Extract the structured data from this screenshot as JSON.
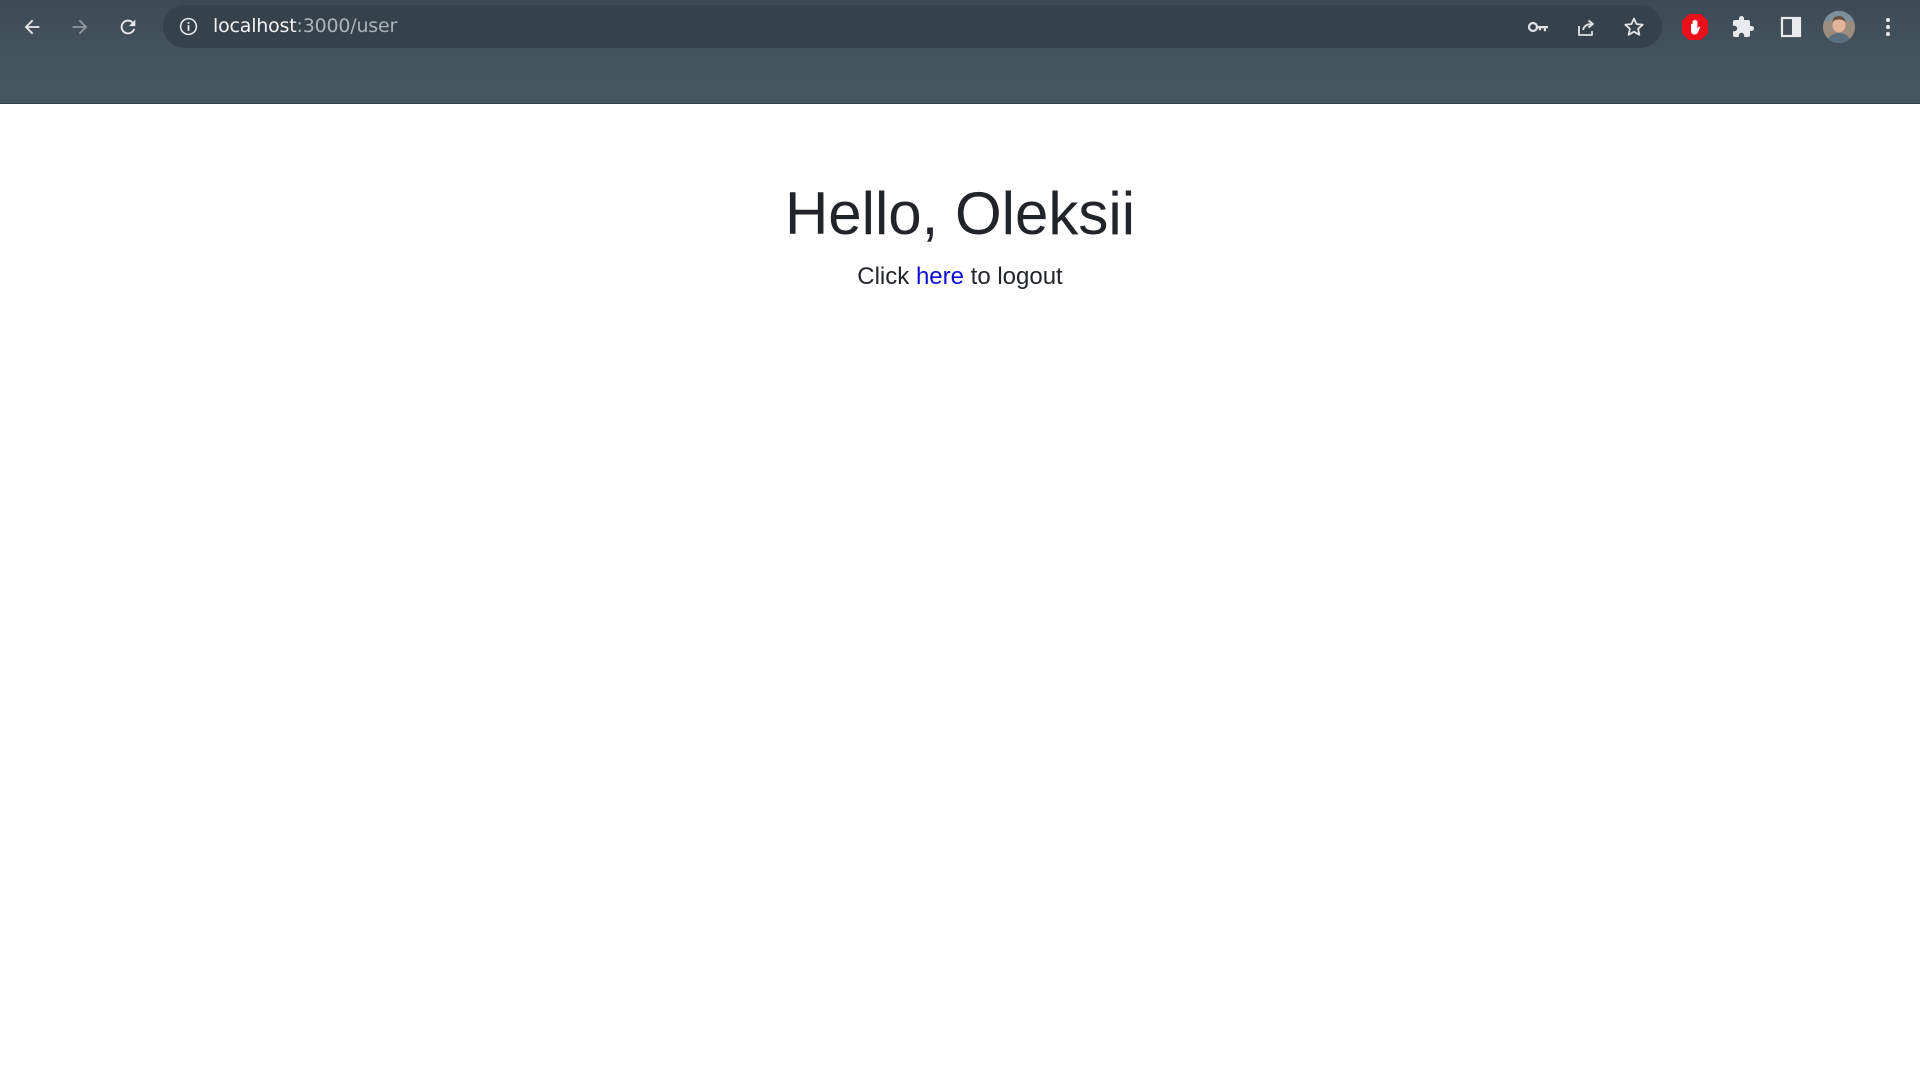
{
  "browser": {
    "url_host": "localhost",
    "url_path": ":3000/user",
    "icons": {
      "back": "arrow-left-icon",
      "forward": "arrow-right-icon",
      "reload": "reload-icon",
      "site_info": "info-icon",
      "password": "key-icon",
      "share": "share-icon",
      "bookmark": "star-icon",
      "extension_blocker": "hand-stop-icon",
      "extensions": "puzzle-icon",
      "side_panel": "side-panel-icon",
      "profile": "avatar",
      "menu": "kebab-menu-icon"
    },
    "colors": {
      "toolbar": "#3c4a54",
      "omnibox": "#36424b",
      "blocker_red": "#e8101b"
    }
  },
  "page": {
    "heading": "Hello, Oleksii",
    "text_before_link": "Click ",
    "link_text": "here",
    "text_after_link": " to logout",
    "colors": {
      "text": "#212529",
      "link": "#0d0dd6",
      "background": "#ffffff"
    }
  }
}
